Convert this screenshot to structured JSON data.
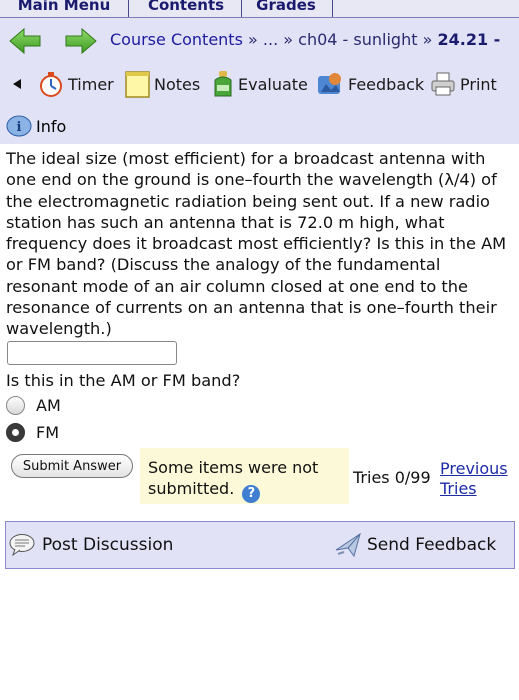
{
  "tabs": [
    "Main Menu",
    "Contents",
    "Grades"
  ],
  "breadcrumb": {
    "course_link": "Course Contents",
    "sep1": "»",
    "ellipsis": "...",
    "sep2": "»",
    "chapter": "ch04 - sunlight",
    "sep3": "»",
    "current": "24.21 -"
  },
  "toolbar": {
    "timer": "Timer",
    "notes": "Notes",
    "evaluate": "Evaluate",
    "feedback": "Feedback",
    "print": "Print",
    "info": "Info"
  },
  "problem": {
    "text": "The ideal size (most efficient) for a broadcast antenna with one end on the ground is one–fourth the wavelength (λ/4) of the electromagnetic radiation being sent out. If a new radio station has such an antenna that is 72.0 m high, what frequency does it broadcast most efficiently? Is this in the AM or FM band? (Discuss the analogy of the fundamental resonant mode of an air column closed at one end to the resonance of currents on an antenna that is one–fourth their wavelength.)",
    "answer_value": "",
    "subquestion": "Is this in the AM or FM band?",
    "options": [
      {
        "label": "AM",
        "selected": false
      },
      {
        "label": "FM",
        "selected": true
      }
    ]
  },
  "submission": {
    "button": "Submit Answer",
    "status_line1": "Some items were not",
    "status_line2": "submitted.",
    "help_glyph": "?",
    "tries": "Tries 0/99",
    "previous_line1": "Previous",
    "previous_line2": "Tries"
  },
  "footer": {
    "post_discussion": "Post Discussion",
    "send_feedback": "Send Feedback"
  },
  "colors": {
    "header_bg": "#e2e2f7",
    "nav_arrow": "#55b236",
    "status_bg": "#fcf9d8",
    "link": "#1c2ba8"
  }
}
